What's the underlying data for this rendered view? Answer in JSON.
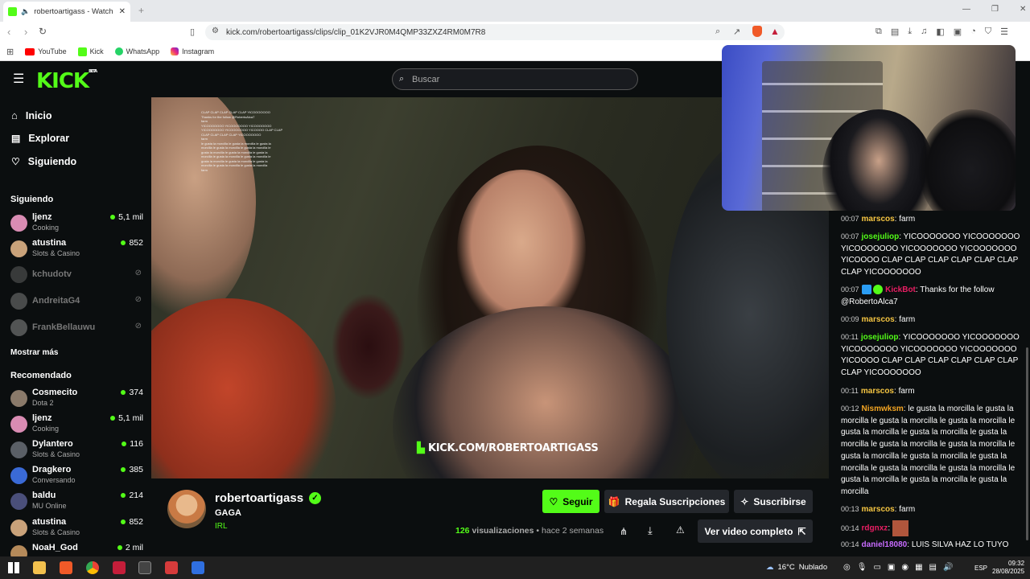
{
  "browser": {
    "tab_title": "robertoartigass - Watch clips",
    "url": "kick.com/robertoartigass/clips/clip_01K2VJR0M4QMP33ZXZ4RM0M7R8",
    "bookmarks": [
      "YouTube",
      "Kick",
      "WhatsApp",
      "Instagram"
    ]
  },
  "kick": {
    "logo": "KICK",
    "logo_beta": "BETA",
    "search_placeholder": "Buscar",
    "nav": [
      "Inicio",
      "Explorar",
      "Siguiendo"
    ],
    "following_title": "Siguiendo",
    "following": [
      {
        "name": "ljenz",
        "category": "Cooking",
        "viewers": "5,1 mil",
        "live": true,
        "color": "#d98cb3"
      },
      {
        "name": "atustina",
        "category": "Slots & Casino",
        "viewers": "852",
        "live": true,
        "color": "#c9a27a"
      },
      {
        "name": "kchudotv",
        "category": "",
        "viewers": "",
        "live": false,
        "color": "#666"
      },
      {
        "name": "AndreitaG4",
        "category": "",
        "viewers": "",
        "live": false,
        "color": "#888"
      },
      {
        "name": "FrankBellauwu",
        "category": "",
        "viewers": "",
        "live": false,
        "color": "#999"
      }
    ],
    "show_more": "Mostrar más",
    "recommended_title": "Recomendado",
    "recommended": [
      {
        "name": "Cosmecito",
        "category": "Dota 2",
        "viewers": "374",
        "color": "#8a7a6a"
      },
      {
        "name": "ljenz",
        "category": "Cooking",
        "viewers": "5,1 mil",
        "color": "#d98cb3"
      },
      {
        "name": "Dylantero",
        "category": "Slots & Casino",
        "viewers": "116",
        "color": "#5a5f66"
      },
      {
        "name": "Dragkero",
        "category": "Conversando",
        "viewers": "385",
        "color": "#3a6ad6"
      },
      {
        "name": "baldu",
        "category": "MU Online",
        "viewers": "214",
        "color": "#4a4f7a"
      },
      {
        "name": "atustina",
        "category": "Slots & Casino",
        "viewers": "852",
        "color": "#c9a27a"
      },
      {
        "name": "NoaH_God",
        "category": "",
        "viewers": "2 mil",
        "color": "#b58a5a"
      }
    ]
  },
  "video": {
    "watermark": "KICK.COM/ROBERTOARTIGASS",
    "overlay_chat": [
      "CLAP CLAP CLAP CLAP CLAP YICOOOOOOO",
      "Thanks for the follow @RobertoAlca7",
      "farm",
      "YICOOOOOOO YICOOOOOOO YICOOOOOOO",
      "YICOOOOOOO YICOOOOOOO YICOOOO CLAP CLAP",
      "CLAP CLAP CLAP CLAP YICOOOOOOO",
      "farm",
      "le gusta la morcilla le gusta la morcilla le gusta la",
      "morcilla le gusta la morcilla le gusta la morcilla le",
      "gusta la morcilla le gusta la morcilla le gusta la",
      "morcilla le gusta la morcilla le gusta la morcilla le",
      "gusta la morcilla le gusta la morcilla le gusta la",
      "morcilla le gusta la morcilla le gusta la morcilla",
      "farm"
    ]
  },
  "clip": {
    "channel": "robertoartigass",
    "title": "GAGA",
    "category": "IRL",
    "follow": "Seguir",
    "gift_subs": "Regala Suscripciones",
    "subscribe": "Suscribirse",
    "views_count": "126",
    "views_label": "visualizaciones",
    "time": "• hace 2 semanas",
    "full_video": "Ver video completo"
  },
  "chat": [
    {
      "time": "00:07",
      "user": "marscos",
      "color": "#f5c542",
      "text": "farm"
    },
    {
      "time": "00:07",
      "user": "josejuliop",
      "color": "#53fc18",
      "text": "YICOOOOOOO YICOOOOOOO YICOOOOOOO YICOOOOOOO YICOOOOOOO YICOOOO CLAP CLAP CLAP CLAP CLAP CLAP CLAP YICOOOOOOO"
    },
    {
      "time": "00:07",
      "user": "KickBot",
      "color": "#e91e63",
      "text": "Thanks for the follow @RobertoAlca7"
    },
    {
      "time": "00:09",
      "user": "marscos",
      "color": "#f5c542",
      "text": "farm"
    },
    {
      "time": "00:11",
      "user": "josejuliop",
      "color": "#53fc18",
      "text": "YICOOOOOOO YICOOOOOOO YICOOOOOOO YICOOOOOOO YICOOOOOOO YICOOOO CLAP CLAP CLAP CLAP CLAP CLAP CLAP YICOOOOOOO"
    },
    {
      "time": "00:11",
      "user": "marscos",
      "color": "#f5c542",
      "text": "farm"
    },
    {
      "time": "00:12",
      "user": "Nismwksm",
      "color": "#f5a623",
      "text": "le gusta la morcilla le gusta la morcilla le gusta la morcilla le gusta la morcilla le gusta la morcilla le gusta la morcilla le gusta la morcilla le gusta la morcilla le gusta la morcilla le gusta la morcilla le gusta la morcilla le gusta la morcilla le gusta la morcilla le gusta la morcilla le gusta la morcilla le gusta la morcilla le gusta la morcilla"
    },
    {
      "time": "00:13",
      "user": "marscos",
      "color": "#f5c542",
      "text": "farm"
    },
    {
      "time": "00:14",
      "user": "rdgnxz",
      "color": "#e91e63",
      "text": ""
    },
    {
      "time": "00:14",
      "user": "daniel18080",
      "color": "#c86bff",
      "text": "LUIS SILVA HAZ LO TUYO"
    }
  ],
  "taskbar": {
    "weather": "16°C",
    "weather_text": "Nublado",
    "lang": "ESP",
    "time": "09:32",
    "date": "28/08/2025"
  }
}
